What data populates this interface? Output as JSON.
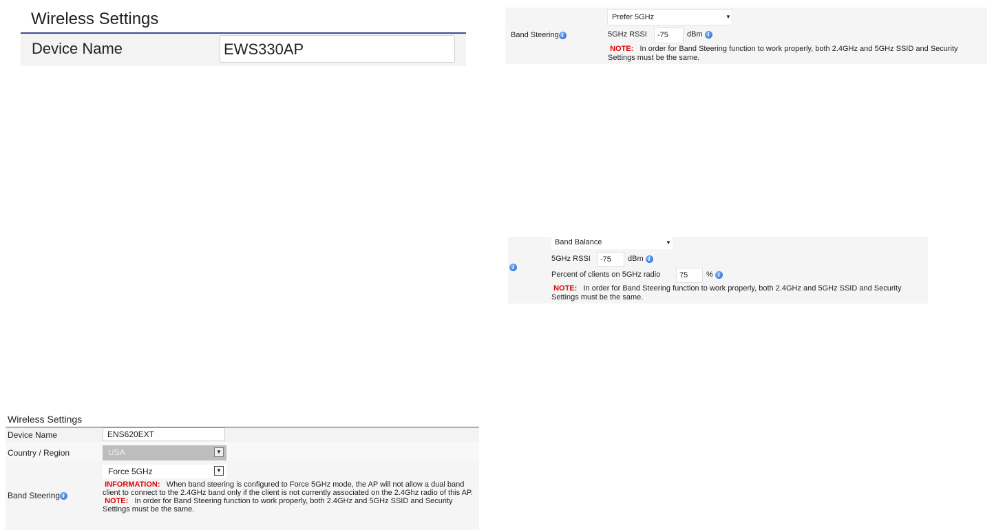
{
  "panel1": {
    "title": "Wireless Settings",
    "device_name_label": "Device Name",
    "device_name_value": "EWS330AP"
  },
  "panel2": {
    "band_steering_label": "Band Steering",
    "mode_selected": "Prefer 5GHz",
    "rssi_label": "5GHz RSSI",
    "rssi_value": "-75",
    "rssi_unit": "dBm",
    "note_label": "NOTE:",
    "note_text": "In order for Band Steering function to work properly, both 2.4GHz and 5GHz SSID and Security Settings must be the same."
  },
  "panel3": {
    "mode_selected": "Band Balance",
    "rssi_label": "5GHz RSSI",
    "rssi_value": "-75",
    "rssi_unit": "dBm",
    "percent_label": "Percent of clients on 5GHz radio",
    "percent_value": "75",
    "percent_unit": "%",
    "note_label": "NOTE:",
    "note_text": "In order for Band Steering function to work properly, both 2.4GHz and 5GHz SSID and Security Settings must be the same."
  },
  "panel4": {
    "title": "Wireless Settings",
    "device_name_label": "Device Name",
    "device_name_value": "ENS620EXT",
    "country_label": "Country / Region",
    "country_value": "USA",
    "band_steering_label": "Band Steering",
    "mode_selected": "Force 5GHz",
    "info_label": "INFORMATION:",
    "info_text": "When band steering is configured to Force 5GHz mode, the AP will not allow a dual band client to connect to the 2.4GHz band only if the client is not currently associated on the 2.4Ghz radio of this AP.",
    "note_label": "NOTE:",
    "note_text": "In order for Band Steering function to work properly, both 2.4GHz and 5GHz SSID and Security Settings must be the same."
  }
}
